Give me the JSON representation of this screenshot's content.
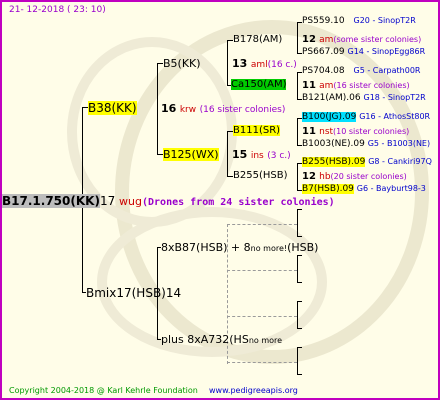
{
  "header": {
    "date": "21- 12-2018 ( 23: 10)"
  },
  "root": {
    "id": "B17.1.750(KK)",
    "num": "17",
    "breeder": "wug",
    "note": "(Drones from 24 sister colonies)"
  },
  "gen1": {
    "mother": {
      "id": "B38(KK)",
      "num": "16",
      "breeder": "krw",
      "note": "(16 sister colonies)"
    },
    "father": {
      "id": "Bmix17(HSB)",
      "num": "14"
    }
  },
  "gen2": {
    "b5": {
      "id": "B5(KK)",
      "num": "13",
      "breeder": "aml",
      "note": "(16 c.)"
    },
    "b125": {
      "id": "B125(WX)",
      "num": "15",
      "breeder": "ins",
      "note": "(3 c.)"
    },
    "x8": {
      "id": "8xB87(HSB) + 8",
      "note": "no more!",
      "suffix": "(HSB)"
    },
    "plus8": {
      "id": "plus 8xA732(HS",
      "note": "no more"
    }
  },
  "gen3": {
    "b178": {
      "id": "B178(AM)",
      "num": "12",
      "breeder": "am",
      "note": "(some sister colonies)"
    },
    "ca150": {
      "id": "Ca150(AM)",
      "num": "11",
      "breeder": "am",
      "note": "(16 sister colonies)"
    },
    "b111": {
      "id": "B111(SR)",
      "num": "11",
      "breeder": "nst",
      "note": "(10 sister colonies)"
    },
    "b255": {
      "id": "B255(HSB)",
      "num": "12",
      "breeder": "hb",
      "note": "(20 sister colonies)"
    }
  },
  "gen4": {
    "ps559": {
      "id": "PS559.10",
      "info": "G20 - SinopT2R"
    },
    "ps667": {
      "id": "PS667.09",
      "info": "G14 - SinopEgg86R"
    },
    "ps704": {
      "id": "PS704.08",
      "info": "G5 - Carpath00R"
    },
    "b121": {
      "id": "B121(AM).06",
      "info": "G18 - SinopT2R"
    },
    "b100": {
      "id": "B100(JG).09",
      "info": "G16 - AthosSt80R"
    },
    "b1003": {
      "id": "B1003(NE).09",
      "info": "G5 - B1003(NE)"
    },
    "b255b": {
      "id": "B255(HSB).09",
      "info": "G8 - Cankiri97Q"
    },
    "b7": {
      "id": "B7(HSB).09",
      "info": "G6 - Bayburt98-3"
    }
  },
  "footer": {
    "copyright": "Copyright 2004-2018 @ Karl Kehrle Foundation",
    "url": "www.pedigreeapis.org"
  }
}
